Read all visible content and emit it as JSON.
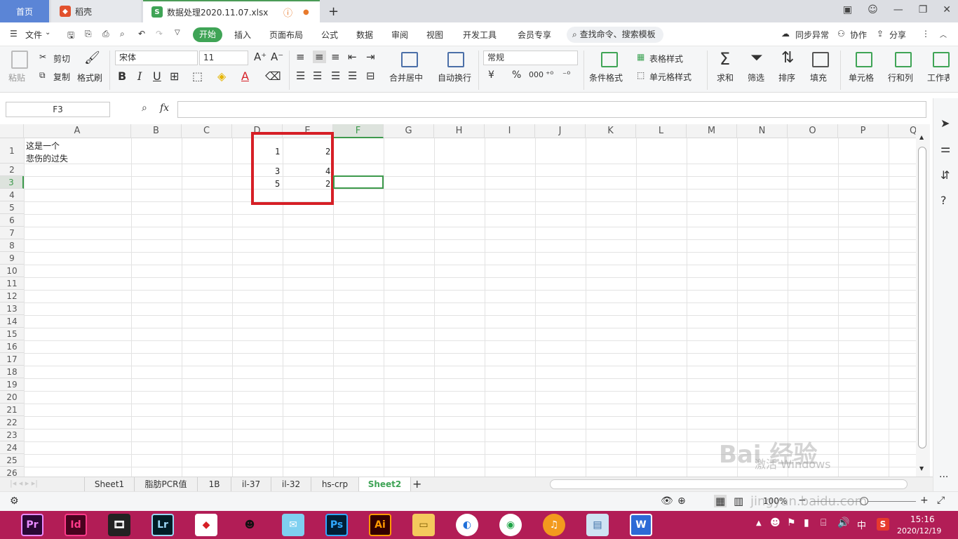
{
  "titlebar": {
    "home_tab": "首页",
    "tab2": "稻壳",
    "active_tab": "数据处理2020.11.07.xlsx",
    "active_tab_icon": "S"
  },
  "menu": {
    "file": "文件",
    "items": [
      "开始",
      "插入",
      "页面布局",
      "公式",
      "数据",
      "审阅",
      "视图",
      "开发工具",
      "会员专享"
    ],
    "search": "查找命令、搜索模板",
    "sync": "同步异常",
    "collab": "协作",
    "share": "分享"
  },
  "ribbon": {
    "paste": "粘贴",
    "cut": "剪切",
    "copy": "复制",
    "format_painter": "格式刷",
    "font_name": "宋体",
    "font_size": "11",
    "bold": "B",
    "italic": "I",
    "underline": "U",
    "merge_center": "合并居中",
    "wrap_text": "自动换行",
    "number_format": "常规",
    "currency": "¥",
    "percent": "%",
    "thousands": "000",
    "cond_format": "条件格式",
    "table_style": "表格样式",
    "cell_style": "单元格样式",
    "sum": "求和",
    "filter": "筛选",
    "sort": "排序",
    "fill": "填充",
    "cell": "单元格",
    "row_col": "行和列",
    "worksheet": "工作表"
  },
  "formula_bar": {
    "name_box": "F3",
    "fx": "fx"
  },
  "grid": {
    "columns": [
      "A",
      "B",
      "C",
      "D",
      "E",
      "F",
      "G",
      "H",
      "I",
      "J",
      "K",
      "L",
      "M",
      "N",
      "O",
      "P",
      "Q"
    ],
    "rows": [
      "1",
      "2",
      "3",
      "4",
      "5",
      "6",
      "7",
      "8",
      "9",
      "10",
      "11",
      "12",
      "13",
      "14",
      "15",
      "16",
      "17",
      "18",
      "19",
      "20",
      "21",
      "22",
      "23",
      "24",
      "25",
      "26"
    ],
    "a1_line1": "这是一个",
    "a1_line2": "悲伤的过失",
    "d1": "1",
    "e1": "2",
    "d2": "3",
    "e2": "4",
    "d3": "5",
    "e3": "2"
  },
  "sheets": [
    "Sheet1",
    "脂肪PCR值",
    "1B",
    "il-37",
    "il-32",
    "hs-crp",
    "Sheet2"
  ],
  "active_sheet": "Sheet2",
  "status": {
    "zoom": "100%"
  },
  "taskbar": {
    "apps": [
      "Pr",
      "Id",
      "Lr",
      "Ps",
      "Ai"
    ],
    "time": "15:16",
    "date": "2020/12/19",
    "ime": "中"
  },
  "watermark": {
    "text": "Bai 经验",
    "url": "jingyan.baidu.com",
    "activate": "激活 Windows"
  },
  "colors": {
    "accent": "#3fa456",
    "highlight": "#d61f26",
    "taskbar": "#b21d56",
    "home_tab": "#5b85d6"
  }
}
